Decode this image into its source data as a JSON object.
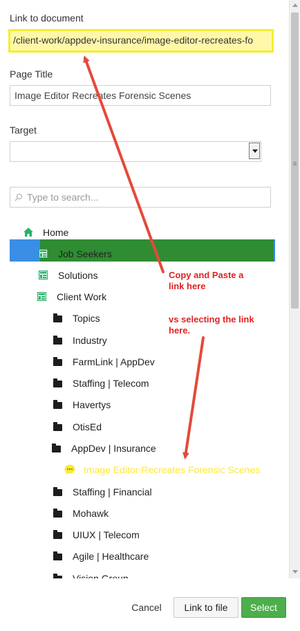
{
  "link_to_document": {
    "label": "Link to document",
    "value": "/client-work/appdev-insurance/image-editor-recreates-fo"
  },
  "page_title": {
    "label": "Page Title",
    "value": "Image Editor Recreates Forensic Scenes"
  },
  "target": {
    "label": "Target",
    "value": ""
  },
  "search": {
    "placeholder": "Type to search..."
  },
  "tree": {
    "items": [
      {
        "label": "Home",
        "icon": "home-icon",
        "level": 0
      },
      {
        "label": "Job Seekers",
        "icon": "page-icon",
        "level": 1
      },
      {
        "label": "Solutions",
        "icon": "page-icon",
        "level": 1
      },
      {
        "label": "Client Work",
        "icon": "page-icon",
        "level": 1
      },
      {
        "label": "Topics",
        "icon": "folder-icon",
        "level": 2
      },
      {
        "label": "Industry",
        "icon": "folder-icon",
        "level": 2
      },
      {
        "label": "FarmLink | AppDev",
        "icon": "folder-icon",
        "level": 2
      },
      {
        "label": "Staffing | Telecom",
        "icon": "folder-icon",
        "level": 2
      },
      {
        "label": "Havertys",
        "icon": "folder-icon",
        "level": 2
      },
      {
        "label": "OtisEd",
        "icon": "folder-icon",
        "level": 2
      },
      {
        "label": "AppDev | Insurance",
        "icon": "folder-open-icon",
        "level": 2
      },
      {
        "label": "Image Editor Recreates Forensic Scenes",
        "icon": "comment-icon",
        "level": 3,
        "selected": true
      },
      {
        "label": "Staffing | Financial",
        "icon": "folder-icon",
        "level": 2
      },
      {
        "label": "Mohawk",
        "icon": "folder-icon",
        "level": 2
      },
      {
        "label": "UIUX | Telecom",
        "icon": "folder-icon",
        "level": 2
      },
      {
        "label": "Agile | Healthcare",
        "icon": "folder-icon",
        "level": 2
      },
      {
        "label": "Vision Group",
        "icon": "folder-icon",
        "level": 2
      }
    ]
  },
  "annotations": {
    "copy_paste": [
      "Copy and Paste a",
      "link here"
    ],
    "vs_selecting": [
      "vs selecting the link",
      "here."
    ]
  },
  "buttons": {
    "cancel": "Cancel",
    "link_to_file": "Link to file",
    "select": "Select"
  },
  "colors": {
    "highlight_fill": "#fff8a8",
    "highlight_border": "#f4ee2e",
    "selected_row": "#2f8c33",
    "selected_outer": "#3a8ee6",
    "selected_text": "#ffe83b",
    "page_icon": "#27b36b",
    "annotation": "#e02222",
    "select_button": "#4cae4c"
  }
}
